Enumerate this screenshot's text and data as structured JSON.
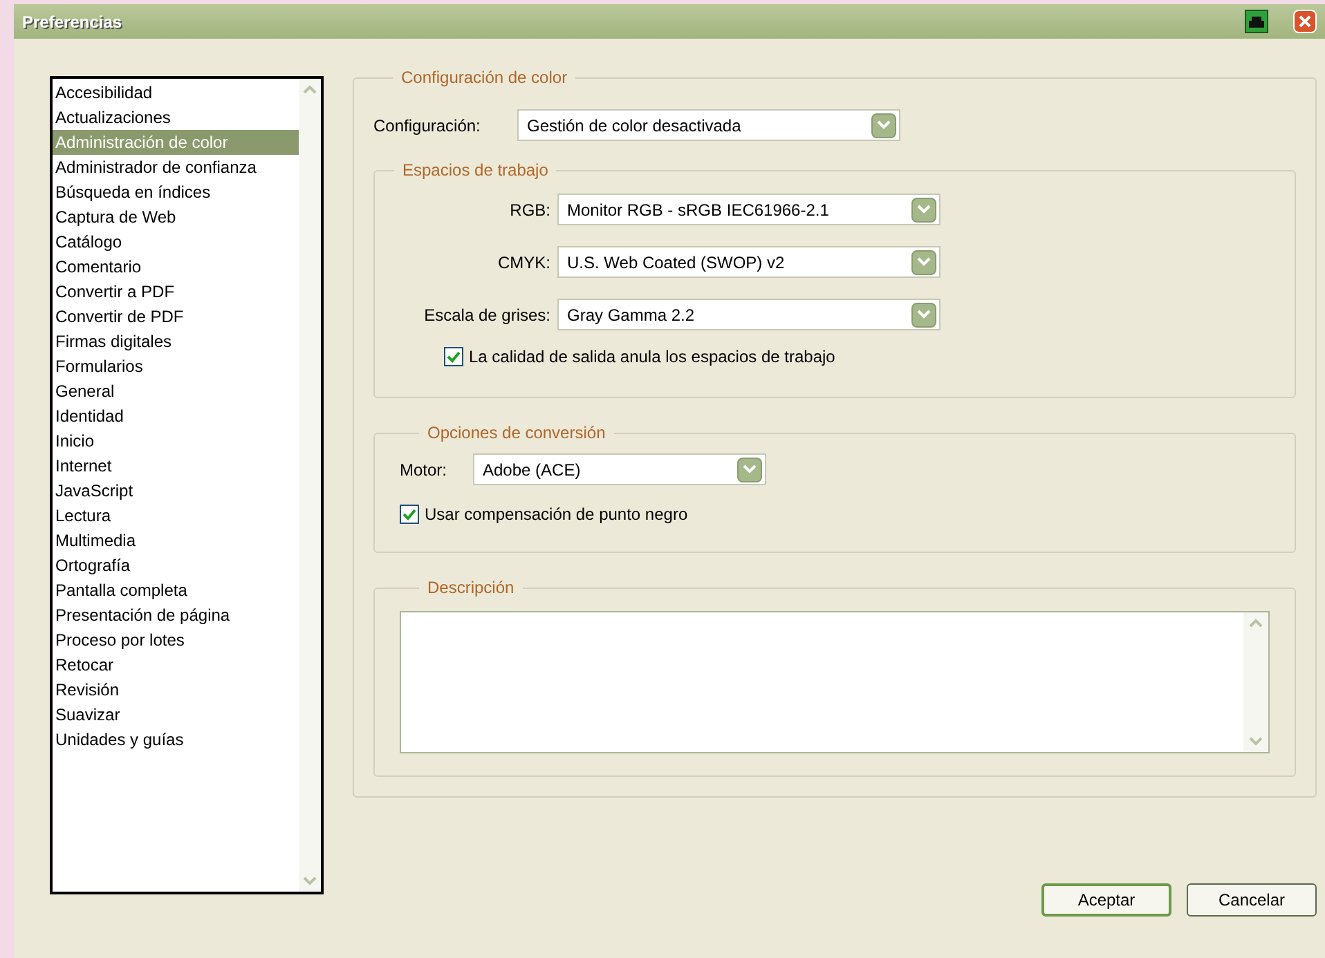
{
  "window": {
    "title": "Preferencias"
  },
  "categories": [
    {
      "label": "Accesibilidad",
      "selected": false
    },
    {
      "label": "Actualizaciones",
      "selected": false
    },
    {
      "label": "Administración de color",
      "selected": true
    },
    {
      "label": "Administrador de confianza",
      "selected": false
    },
    {
      "label": "Búsqueda en índices",
      "selected": false
    },
    {
      "label": "Captura de Web",
      "selected": false
    },
    {
      "label": "Catálogo",
      "selected": false
    },
    {
      "label": "Comentario",
      "selected": false
    },
    {
      "label": "Convertir a PDF",
      "selected": false
    },
    {
      "label": "Convertir de PDF",
      "selected": false
    },
    {
      "label": "Firmas digitales",
      "selected": false
    },
    {
      "label": "Formularios",
      "selected": false
    },
    {
      "label": "General",
      "selected": false
    },
    {
      "label": "Identidad",
      "selected": false
    },
    {
      "label": "Inicio",
      "selected": false
    },
    {
      "label": "Internet",
      "selected": false
    },
    {
      "label": "JavaScript",
      "selected": false
    },
    {
      "label": "Lectura",
      "selected": false
    },
    {
      "label": "Multimedia",
      "selected": false
    },
    {
      "label": "Ortografía",
      "selected": false
    },
    {
      "label": "Pantalla completa",
      "selected": false
    },
    {
      "label": "Presentación de página",
      "selected": false
    },
    {
      "label": "Proceso por lotes",
      "selected": false
    },
    {
      "label": "Retocar",
      "selected": false
    },
    {
      "label": "Revisión",
      "selected": false
    },
    {
      "label": "Suavizar",
      "selected": false
    },
    {
      "label": "Unidades y guías",
      "selected": false
    }
  ],
  "color_settings": {
    "title": "Configuración de color",
    "label": "Configuración:",
    "value": "Gestión de color desactivada"
  },
  "working_spaces": {
    "title": "Espacios de trabajo",
    "fields": [
      {
        "label": "RGB:",
        "value": "Monitor RGB - sRGB IEC61966-2.1"
      },
      {
        "label": "CMYK:",
        "value": "U.S. Web Coated (SWOP) v2"
      },
      {
        "label": "Escala de grises:",
        "value": "Gray Gamma 2.2"
      }
    ],
    "checkbox": {
      "label": "La calidad de salida anula los espacios de trabajo",
      "checked": true
    }
  },
  "conversion": {
    "title": "Opciones de conversión",
    "engine_label": "Motor:",
    "engine_value": "Adobe (ACE)",
    "checkbox": {
      "label": "Usar compensación de punto negro",
      "checked": true
    }
  },
  "description": {
    "title": "Descripción"
  },
  "buttons": [
    "Aceptar",
    "Cancelar"
  ]
}
